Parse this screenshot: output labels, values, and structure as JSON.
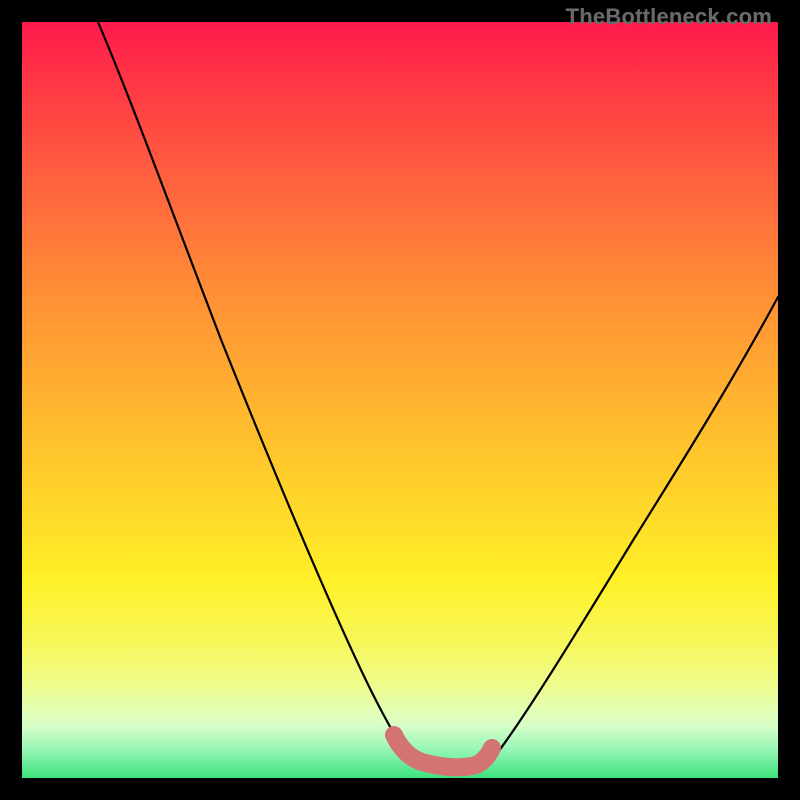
{
  "watermark": "TheBottleneck.com",
  "colors": {
    "frame": "#000000",
    "line": "#000000",
    "worm": "#d47373",
    "gradient_top": "#ff1a4d",
    "gradient_bottom": "#3de27e"
  },
  "chart_data": {
    "type": "line",
    "title": "",
    "xlabel": "",
    "ylabel": "",
    "xlim": [
      0,
      100
    ],
    "ylim": [
      0,
      100
    ],
    "grid": false,
    "note": "Axes unlabeled in source image; x/y normalized to 0–100 of plot area. y=0 at bottom (green), y=100 at top (red).",
    "series": [
      {
        "name": "left-curve",
        "x": [
          10,
          15,
          20,
          25,
          30,
          35,
          40,
          45,
          49,
          51
        ],
        "y": [
          100,
          88,
          75,
          62,
          49,
          36,
          24,
          13,
          5,
          2
        ]
      },
      {
        "name": "right-curve",
        "x": [
          62,
          65,
          70,
          75,
          80,
          85,
          90,
          95,
          100
        ],
        "y": [
          2,
          6,
          14,
          23,
          32,
          41,
          49,
          57,
          64
        ]
      },
      {
        "name": "valley-marker",
        "x": [
          49,
          51,
          55,
          59,
          62
        ],
        "y": [
          5,
          2,
          1.5,
          2,
          3.5
        ],
        "style": "thick-pink"
      }
    ]
  }
}
